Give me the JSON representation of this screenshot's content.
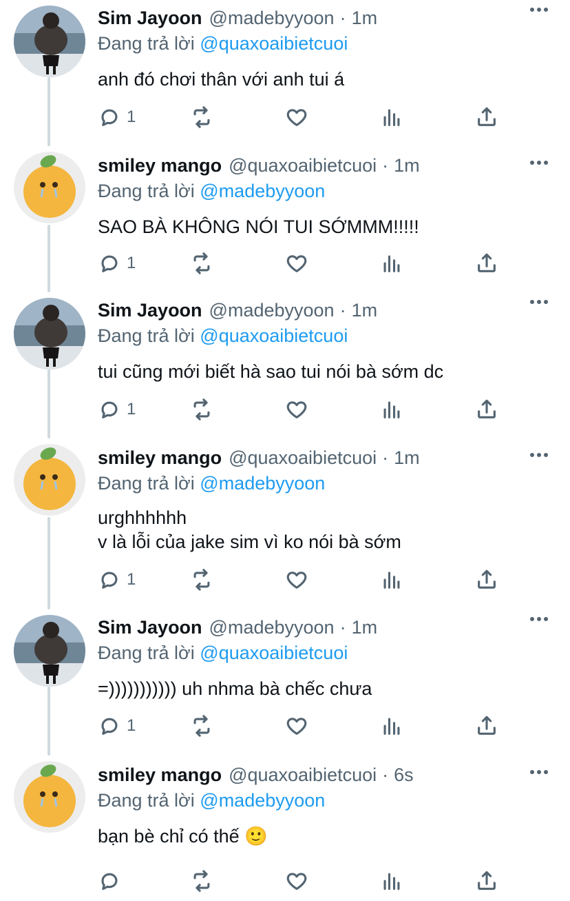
{
  "replying_prefix": "Đang trả lời",
  "tweets": [
    {
      "name": "Sim Jayoon",
      "handle": "@madebyyoon",
      "time": "1m",
      "reply_to": "@quaxoaibietcuoi",
      "text": "anh đó chơi thân với anh tui á",
      "reply_count": "1",
      "avatar": "girl-photo-avatar"
    },
    {
      "name": "smiley mango",
      "handle": "@quaxoaibietcuoi",
      "time": "1m",
      "reply_to": "@madebyyoon",
      "text": "SAO BÀ KHÔNG NÓI TUI SỚMMM!!!!!",
      "reply_count": "1",
      "avatar": "crying-mango-avatar"
    },
    {
      "name": "Sim Jayoon",
      "handle": "@madebyyoon",
      "time": "1m",
      "reply_to": "@quaxoaibietcuoi",
      "text": "tui cũng mới biết hà sao tui nói bà sớm dc",
      "reply_count": "1",
      "avatar": "girl-photo-avatar"
    },
    {
      "name": "smiley mango",
      "handle": "@quaxoaibietcuoi",
      "time": "1m",
      "reply_to": "@madebyyoon",
      "text": "urghhhhhh\nv là lỗi của jake sim vì ko nói bà sớm",
      "reply_count": "1",
      "avatar": "crying-mango-avatar"
    },
    {
      "name": "Sim Jayoon",
      "handle": "@madebyyoon",
      "time": "1m",
      "reply_to": "@quaxoaibietcuoi",
      "text": "=))))))))))) uh nhma bà chếc chưa",
      "reply_count": "1",
      "avatar": "girl-photo-avatar"
    },
    {
      "name": "smiley mango",
      "handle": "@quaxoaibietcuoi",
      "time": "6s",
      "reply_to": "@madebyyoon",
      "text": "bạn bè chỉ có thế 🙂",
      "reply_count": "",
      "avatar": "crying-mango-avatar"
    }
  ],
  "colors": {
    "accent": "#1d9bf0",
    "secondary_text": "#536471",
    "primary_text": "#0f1419",
    "thread_line": "#cfd9de"
  }
}
